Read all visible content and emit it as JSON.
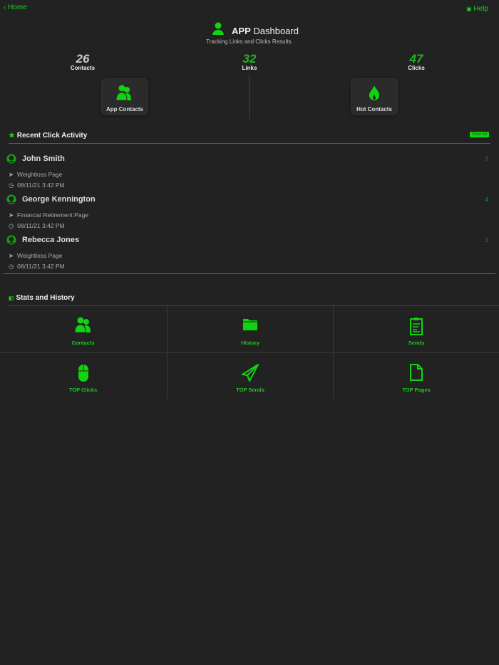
{
  "nav": {
    "back_label": "Home",
    "help_label": "Help"
  },
  "header": {
    "title_bold": "APP",
    "title_rest": "Dashboard",
    "subtitle": "Tracking Links and Clicks Results."
  },
  "stats": [
    {
      "value": "26",
      "label": "Contacts"
    },
    {
      "value": "32",
      "label": "Links"
    },
    {
      "value": "47",
      "label": "Clicks"
    }
  ],
  "tiles": {
    "app_contacts": "App Contacts",
    "hot_contacts": "Hot Contacts"
  },
  "recent": {
    "title": "Recent Click Activity",
    "view_all": "View All",
    "items": [
      {
        "name": "John Smith",
        "count": "7",
        "page": "Weightloss Page",
        "time": "08/11/21 3:42 PM"
      },
      {
        "name": "George Kennington",
        "count": "4",
        "page": "Financial Retirement Page",
        "time": "08/11/21 3:42 PM"
      },
      {
        "name": "Rebecca Jones",
        "count": "2",
        "page": "Weightloss Page",
        "time": "08/11/21 3:42 PM"
      }
    ]
  },
  "stats_history": {
    "title": "Stats and History",
    "cells": [
      "Contacts",
      "History",
      "Sends",
      "TOP Clicks",
      "TOP Sends",
      "TOP Pages"
    ]
  },
  "colors": {
    "accent": "#1fd31f",
    "background": "#222222"
  }
}
